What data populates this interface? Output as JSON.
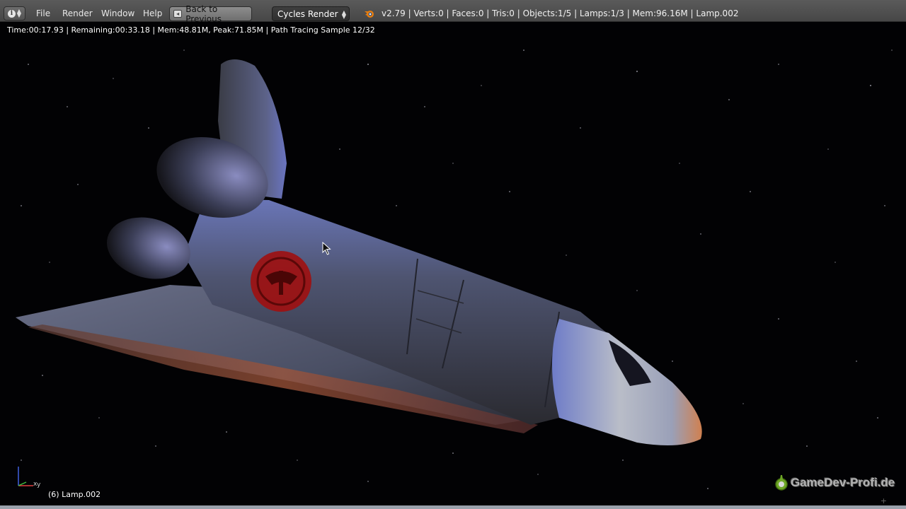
{
  "header": {
    "editor_type_icon": "info-icon",
    "menu": [
      "File",
      "Render",
      "Window",
      "Help"
    ],
    "back_button": "Back to Previous",
    "render_engine": "Cycles Render",
    "blender_icon": "blender-logo-icon",
    "stats": "v2.79 | Verts:0 | Faces:0 | Tris:0 | Objects:1/5 | Lamps:1/3 | Mem:96.16M | Lamp.002"
  },
  "viewport": {
    "render_info": "Time:00:17.93 | Remaining:00:33.18 | Mem:48.81M, Peak:71.85M | Path Tracing Sample 12/32",
    "object_label": "(6) Lamp.002",
    "axis_labels": {
      "x": "x",
      "y": "y"
    },
    "watermark": "GameDev-Profi.de"
  },
  "colors": {
    "header_bg": "#4f4f4f",
    "emblem_red": "#a01010",
    "shuttle_blue": "#5a6ab8",
    "nose_orange": "#c86a3a"
  }
}
